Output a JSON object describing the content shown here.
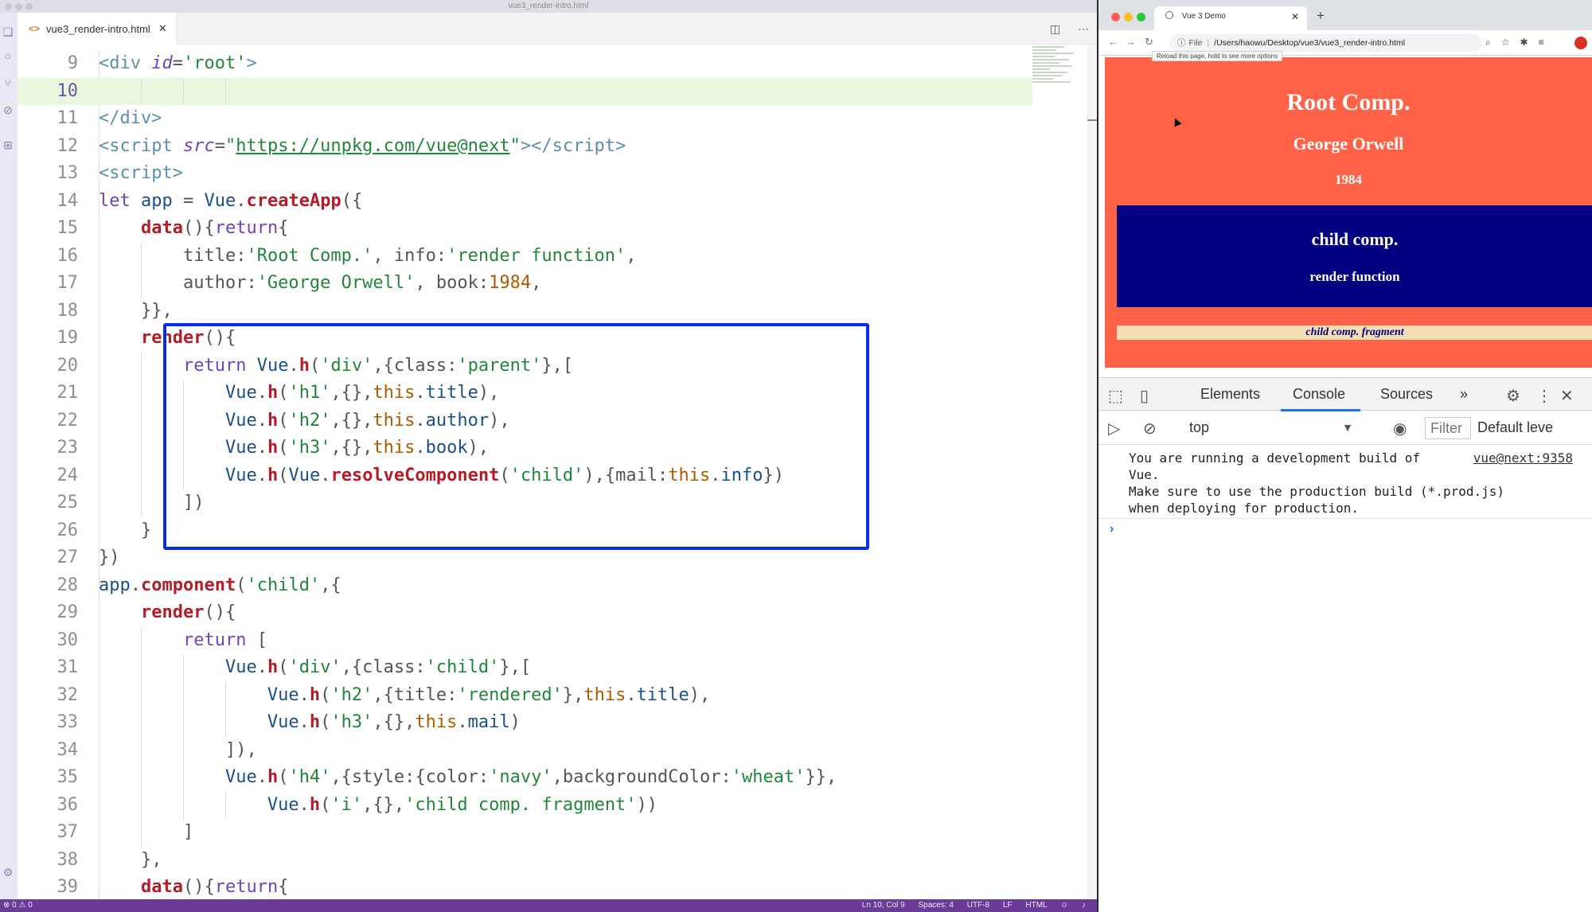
{
  "editor": {
    "window_title": "vue3_render-intro.html",
    "tab_name": "vue3_render-intro.html",
    "code_lines": [
      {
        "num": "9",
        "html": "<span class=\"t\">&lt;div</span> <span class=\"a\">id</span><span class=\"p\">=</span><span class=\"s\">'root'</span><span class=\"t\">&gt;</span>"
      },
      {
        "num": "10",
        "html": ""
      },
      {
        "num": "11",
        "html": "<span class=\"t\">&lt;/div&gt;</span>"
      },
      {
        "num": "12",
        "html": "<span class=\"t\">&lt;script</span> <span class=\"a\">src</span><span class=\"p\">=</span><span class=\"s\">\"</span><span class=\"u\">https://unpkg.com/vue@next</span><span class=\"s\">\"</span><span class=\"t\">&gt;&lt;/script&gt;</span>"
      },
      {
        "num": "13",
        "html": "<span class=\"t\">&lt;script&gt;</span>"
      },
      {
        "num": "14",
        "html": "<span class=\"k\">let</span> <span class=\"v\">app</span> <span class=\"p\">=</span> <span class=\"v\">Vue</span><span class=\"p\">.</span><span class=\"f\">createApp</span><span class=\"p\">({</span>"
      },
      {
        "num": "15",
        "html": "    <span class=\"f\">data</span><span class=\"p\">(){</span><span class=\"k\">return</span><span class=\"p\">{</span>"
      },
      {
        "num": "16",
        "html": "        <span class=\"p\">title:</span><span class=\"s\">'Root Comp.'</span><span class=\"p\">, info:</span><span class=\"s\">'render function'</span><span class=\"p\">,</span>"
      },
      {
        "num": "17",
        "html": "        <span class=\"p\">author:</span><span class=\"s\">'George Orwell'</span><span class=\"p\">, book:</span><span class=\"n\">1984</span><span class=\"p\">,</span>"
      },
      {
        "num": "18",
        "html": "    <span class=\"p\">}},</span>"
      },
      {
        "num": "19",
        "html": "    <span class=\"f\">render</span><span class=\"p\">(){</span>"
      },
      {
        "num": "20",
        "html": "        <span class=\"k\">return</span> <span class=\"v\">Vue</span><span class=\"p\">.</span><span class=\"f\">h</span><span class=\"p\">(</span><span class=\"s\">'div'</span><span class=\"p\">,{class:</span><span class=\"s\">'parent'</span><span class=\"p\">},[</span>"
      },
      {
        "num": "21",
        "html": "            <span class=\"v\">Vue</span><span class=\"p\">.</span><span class=\"f\">h</span><span class=\"p\">(</span><span class=\"s\">'h1'</span><span class=\"p\">,{},</span><span class=\"n\">this</span><span class=\"p\">.</span><span class=\"v\">title</span><span class=\"p\">),</span>"
      },
      {
        "num": "22",
        "html": "            <span class=\"v\">Vue</span><span class=\"p\">.</span><span class=\"f\">h</span><span class=\"p\">(</span><span class=\"s\">'h2'</span><span class=\"p\">,{},</span><span class=\"n\">this</span><span class=\"p\">.</span><span class=\"v\">author</span><span class=\"p\">),</span>"
      },
      {
        "num": "23",
        "html": "            <span class=\"v\">Vue</span><span class=\"p\">.</span><span class=\"f\">h</span><span class=\"p\">(</span><span class=\"s\">'h3'</span><span class=\"p\">,{},</span><span class=\"n\">this</span><span class=\"p\">.</span><span class=\"v\">book</span><span class=\"p\">),</span>"
      },
      {
        "num": "24",
        "html": "            <span class=\"v\">Vue</span><span class=\"p\">.</span><span class=\"f\">h</span><span class=\"p\">(</span><span class=\"v\">Vue</span><span class=\"p\">.</span><span class=\"f\">resolveComponent</span><span class=\"p\">(</span><span class=\"s\">'child'</span><span class=\"p\">),{mail:</span><span class=\"n\">this</span><span class=\"p\">.</span><span class=\"v\">info</span><span class=\"p\">})</span>"
      },
      {
        "num": "25",
        "html": "        <span class=\"p\">])</span>"
      },
      {
        "num": "26",
        "html": "    <span class=\"p\">}</span>"
      },
      {
        "num": "27",
        "html": "<span class=\"p\">})</span>"
      },
      {
        "num": "28",
        "html": "<span class=\"v\">app</span><span class=\"p\">.</span><span class=\"f\">component</span><span class=\"p\">(</span><span class=\"s\">'child'</span><span class=\"p\">,{</span>"
      },
      {
        "num": "29",
        "html": "    <span class=\"f\">render</span><span class=\"p\">(){</span>"
      },
      {
        "num": "30",
        "html": "        <span class=\"k\">return</span> <span class=\"p\">[</span>"
      },
      {
        "num": "31",
        "html": "            <span class=\"v\">Vue</span><span class=\"p\">.</span><span class=\"f\">h</span><span class=\"p\">(</span><span class=\"s\">'div'</span><span class=\"p\">,{class:</span><span class=\"s\">'child'</span><span class=\"p\">},[</span>"
      },
      {
        "num": "32",
        "html": "                <span class=\"v\">Vue</span><span class=\"p\">.</span><span class=\"f\">h</span><span class=\"p\">(</span><span class=\"s\">'h2'</span><span class=\"p\">,{title:</span><span class=\"s\">'rendered'</span><span class=\"p\">},</span><span class=\"n\">this</span><span class=\"p\">.</span><span class=\"v\">title</span><span class=\"p\">),</span>"
      },
      {
        "num": "33",
        "html": "                <span class=\"v\">Vue</span><span class=\"p\">.</span><span class=\"f\">h</span><span class=\"p\">(</span><span class=\"s\">'h3'</span><span class=\"p\">,{},</span><span class=\"n\">this</span><span class=\"p\">.</span><span class=\"v\">mail</span><span class=\"p\">)</span>"
      },
      {
        "num": "34",
        "html": "            <span class=\"p\">]),</span>"
      },
      {
        "num": "35",
        "html": "            <span class=\"v\">Vue</span><span class=\"p\">.</span><span class=\"f\">h</span><span class=\"p\">(</span><span class=\"s\">'h4'</span><span class=\"p\">,{style:{color:</span><span class=\"s\">'navy'</span><span class=\"p\">,backgroundColor:</span><span class=\"s\">'wheat'</span><span class=\"p\">}},</span>"
      },
      {
        "num": "36",
        "html": "                <span class=\"v\">Vue</span><span class=\"p\">.</span><span class=\"f\">h</span><span class=\"p\">(</span><span class=\"s\">'i'</span><span class=\"p\">,{},</span><span class=\"s\">'child comp. fragment'</span><span class=\"p\">))</span>"
      },
      {
        "num": "37",
        "html": "        <span class=\"p\">]</span>"
      },
      {
        "num": "38",
        "html": "    <span class=\"p\">},</span>"
      },
      {
        "num": "39",
        "html": "    <span class=\"f\">data</span><span class=\"p\">(){</span><span class=\"k\">return</span><span class=\"p\">{</span>"
      }
    ],
    "current_line": "10",
    "status": {
      "left": "⊗ 0  ⚠ 0",
      "position": "Ln 10, Col 9",
      "spaces": "Spaces: 4",
      "encoding": "UTF-8",
      "eol": "LF",
      "language": "HTML"
    }
  },
  "browser": {
    "tab_title": "Vue 3 Demo",
    "url_label": "File",
    "url": "/Users/haowu/Desktop/vue3/vue3_render-intro.html",
    "tooltip": "Reload this page, hold to see more options",
    "avatar_letter": "",
    "page": {
      "h1": "Root Comp.",
      "h2": "George Orwell",
      "h3": "1984",
      "child_h2": "child comp.",
      "child_h3": "render function",
      "fragment": "child comp. fragment",
      "colors": {
        "root_bg": "#ff6347",
        "child_bg": "#000080",
        "fragment_bg": "#f5deb3",
        "fragment_text": "#000080"
      }
    },
    "devtools": {
      "tabs": [
        "Elements",
        "Console",
        "Sources"
      ],
      "active_tab": "Console",
      "overflow": "»",
      "context": "top",
      "filter_placeholder": "Filter",
      "levels": "Default leve",
      "message": "You are running a development build of\nVue.\nMake sure to use the production build (*.prod.js)\nwhen deploying for production.",
      "message_source": "vue@next:9358",
      "prompt": "›"
    }
  }
}
